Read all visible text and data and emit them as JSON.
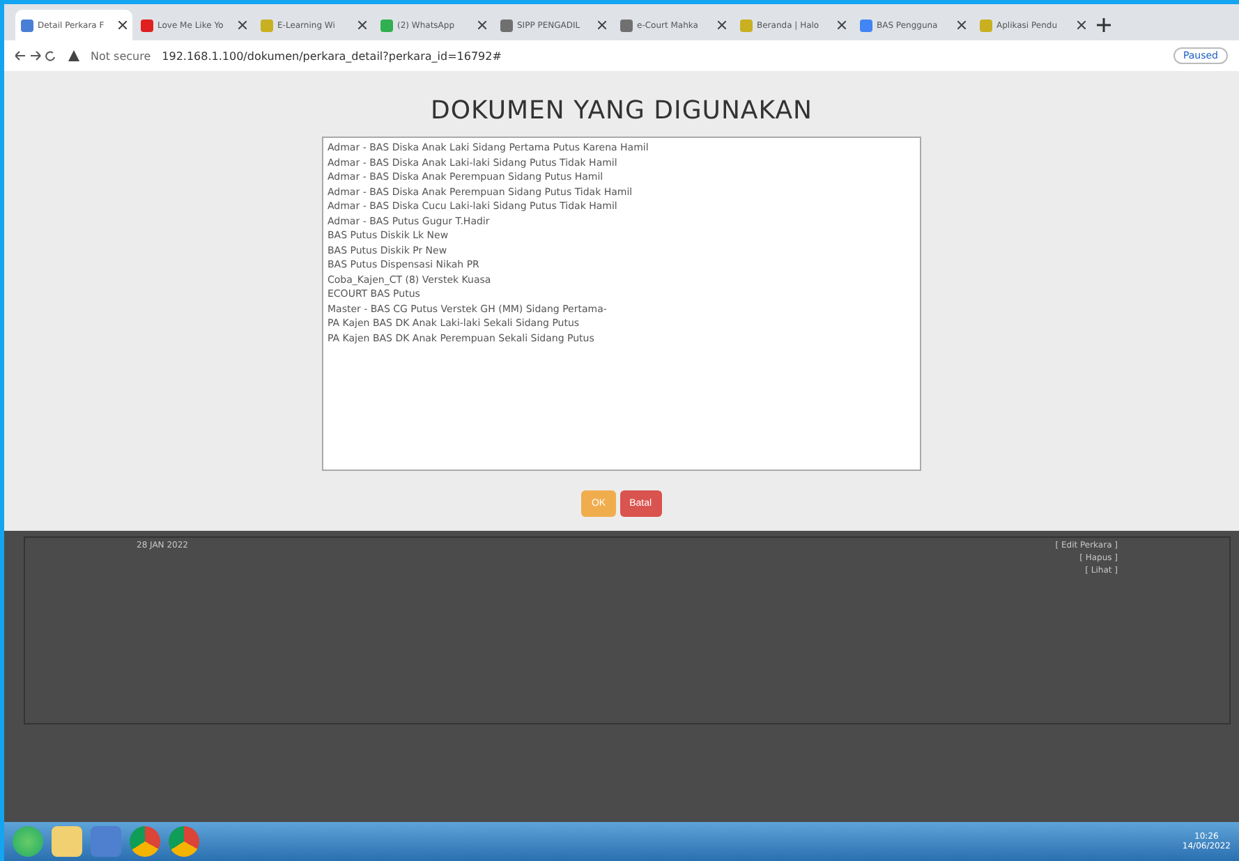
{
  "browser": {
    "tabs": [
      {
        "title": "Detail Perkara F",
        "selected": true,
        "color": "#4a7fd6"
      },
      {
        "title": "Love Me Like Yo",
        "selected": false,
        "color": "#e02020"
      },
      {
        "title": "E-Learning Wi",
        "selected": false,
        "color": "#c8b020"
      },
      {
        "title": "(2) WhatsApp",
        "selected": false,
        "color": "#30b050"
      },
      {
        "title": "SIPP PENGADIL",
        "selected": false,
        "color": "#707070"
      },
      {
        "title": "e-Court Mahka",
        "selected": false,
        "color": "#707070"
      },
      {
        "title": "Beranda | Halo",
        "selected": false,
        "color": "#c8b020"
      },
      {
        "title": "BAS Pengguna",
        "selected": false,
        "color": "#4285f4"
      },
      {
        "title": "Aplikasi Pendu",
        "selected": false,
        "color": "#c8b020"
      }
    ],
    "security": "Not secure",
    "url": "192.168.1.100/dokumen/perkara_detail?perkara_id=16792#",
    "profile": "Paused"
  },
  "modal": {
    "title": "DOKUMEN YANG DIGUNAKAN",
    "documents": [
      "Admar - BAS Diska Anak Laki Sidang Pertama Putus Karena Hamil",
      "Admar - BAS Diska Anak Laki-laki Sidang Putus Tidak Hamil",
      "Admar - BAS Diska Anak Perempuan Sidang Putus Hamil",
      "Admar - BAS Diska Anak Perempuan Sidang Putus Tidak Hamil",
      "Admar - BAS Diska Cucu Laki-laki Sidang Putus Tidak Hamil",
      "Admar - BAS Putus Gugur T.Hadir",
      "BAS Putus Diskik Lk New",
      "BAS Putus Diskik Pr New",
      "BAS Putus Dispensasi Nikah PR",
      "Coba_Kajen_CT (8) Verstek Kuasa",
      "ECOURT BAS Putus",
      "Master - BAS CG Putus Verstek GH (MM) Sidang Pertama-",
      "PA Kajen BAS DK Anak Laki-laki Sekali Sidang Putus",
      "PA Kajen BAS DK Anak Perempuan Sekali Sidang Putus"
    ],
    "buttons": [
      {
        "label": "OK",
        "kind": "ok"
      },
      {
        "label": "Batal",
        "kind": "cancel"
      }
    ]
  },
  "background": {
    "date": "28 JAN 2022",
    "actions": [
      "[ Edit Perkara ]",
      "[ Hapus ]",
      "[ Lihat ]"
    ]
  },
  "taskbar": {
    "time": "10:26",
    "date": "14/06/2022"
  }
}
